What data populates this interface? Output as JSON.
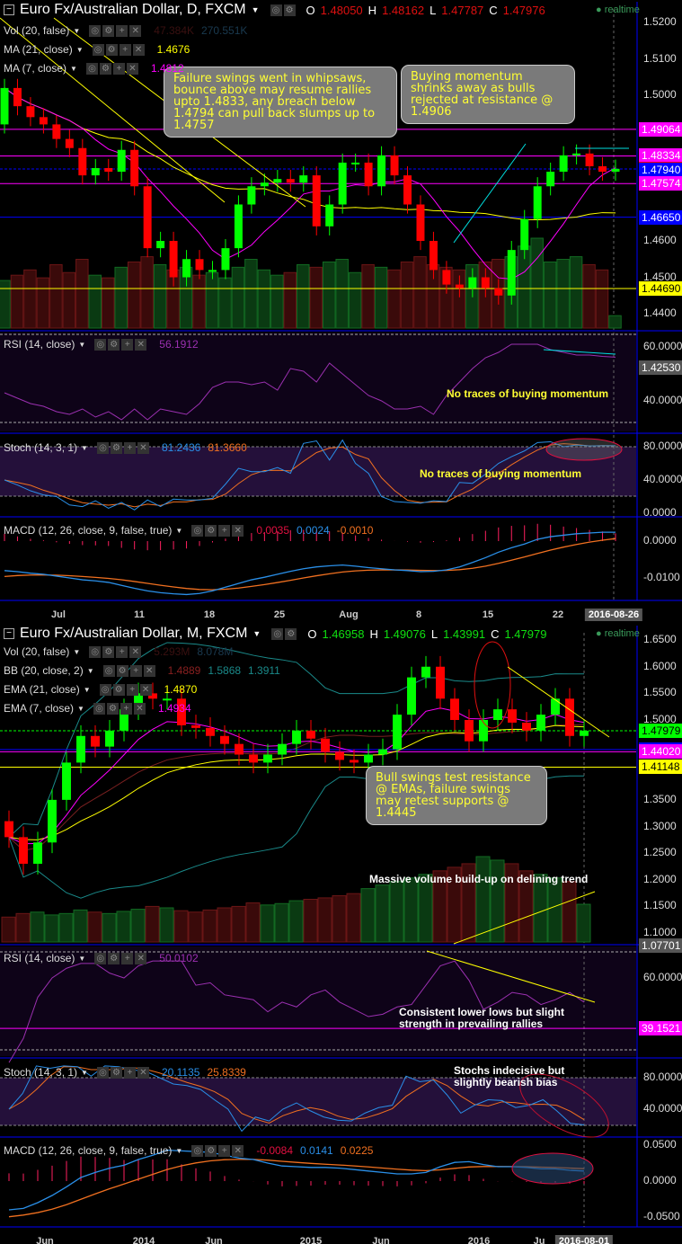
{
  "top": {
    "title": "Euro Fx/Australian Dollar, D, FXCM",
    "o_label": "O",
    "o": "1.48050",
    "h_label": "H",
    "h": "1.48162",
    "l_label": "L",
    "l": "1.47787",
    "c_label": "C",
    "c": "1.47976",
    "realtime": "realtime",
    "indicators": [
      {
        "label": "Vol (20, false)",
        "values": [
          "47.384K",
          "270.551K"
        ]
      },
      {
        "label": "MA (21, close)",
        "values": [
          "1.4676"
        ]
      },
      {
        "label": "MA (7, close)",
        "values": [
          "1.4812"
        ]
      }
    ],
    "rsi": {
      "label": "RSI (14, close)",
      "value": "56.1912"
    },
    "stoch": {
      "label": "Stoch (14, 3, 1)",
      "k": "81.2436",
      "d": "81.3660"
    },
    "macd": {
      "label": "MACD (12, 26, close, 9, false, true)",
      "hist": "0.0035",
      "macd": "0.0024",
      "signal": "-0.0010"
    },
    "notes": [
      "Failure swings went in whipsaws, bounce above may resume rallies upto 1.4833, any breach below 1.4794 can pull back slumps up to 1.4757",
      "Buying momentum shrinks away as bulls rejected at resistance @ 1.4906",
      "No traces of buying momentum",
      "No traces of buying momentum"
    ],
    "price_ticks": [
      "1.5200",
      "1.5100",
      "1.5000",
      "1.4600",
      "1.4500",
      "1.4400"
    ],
    "markers": [
      {
        "text": "1.49064",
        "bg": "#ff00ff",
        "fg": "#fff"
      },
      {
        "text": "1.48334",
        "bg": "#ff00ff",
        "fg": "#fff"
      },
      {
        "text": "1.47976",
        "bg": "#ff0000",
        "fg": "#fff"
      },
      {
        "text": "1.47940",
        "bg": "#0000ff",
        "fg": "#fff"
      },
      {
        "text": "1.47574",
        "bg": "#ff00ff",
        "fg": "#fff"
      },
      {
        "text": "1.46650",
        "bg": "#0000ff",
        "fg": "#fff"
      },
      {
        "text": "1.44690",
        "bg": "#ffff00",
        "fg": "#000"
      },
      {
        "text": "1.42530",
        "bg": "#555",
        "fg": "#fff"
      }
    ],
    "rsi_ticks": [
      "60.0000",
      "40.0000"
    ],
    "stoch_ticks": [
      "80.0000",
      "40.0000",
      "0.0000"
    ],
    "macd_ticks": [
      "0.0000",
      "-0.0100"
    ],
    "time_labels": [
      "Jul",
      "11",
      "18",
      "25",
      "Aug",
      "8",
      "15",
      "22"
    ],
    "date_box": "2016-08-26"
  },
  "bottom": {
    "title": "Euro Fx/Australian Dollar, M, FXCM",
    "o_label": "O",
    "o": "1.46958",
    "h_label": "H",
    "h": "1.49076",
    "l_label": "L",
    "l": "1.43991",
    "c_label": "C",
    "c": "1.47979",
    "realtime": "realtime",
    "indicators": [
      {
        "label": "Vol (20, false)",
        "values": [
          "5.293M",
          "8.078M"
        ]
      },
      {
        "label": "BB (20, close, 2)",
        "values": [
          "1.4889",
          "1.5868",
          "1.3911"
        ]
      },
      {
        "label": "EMA (21, close)",
        "values": [
          "1.4870"
        ]
      },
      {
        "label": "EMA (7, close)",
        "values": [
          "1.4934"
        ]
      }
    ],
    "rsi": {
      "label": "RSI (14, close)",
      "value": "50.0102"
    },
    "stoch": {
      "label": "Stoch (14, 3, 1)",
      "k": "20.1135",
      "d": "25.8339"
    },
    "macd": {
      "label": "MACD (12, 26, close, 9, false, true)",
      "hist": "-0.0084",
      "macd": "0.0141",
      "signal": "0.0225"
    },
    "notes": [
      "Bull swings test resistance @ EMAs, failure swings may retest supports @ 1.4445",
      "Massive volume build-up on delining trend",
      "Consistent lower lows but slight strength in prevailing rallies",
      "Stochs indecisive but slightly bearish bias"
    ],
    "price_ticks": [
      "1.6500",
      "1.6000",
      "1.5500",
      "1.5000",
      "1.3500",
      "1.3000",
      "1.2500",
      "1.2000",
      "1.1500",
      "1.1000"
    ],
    "markers": [
      {
        "text": "1.47979",
        "bg": "#00ff00",
        "fg": "#000"
      },
      {
        "text": "1.44457",
        "bg": "#0000ff",
        "fg": "#fff"
      },
      {
        "text": "1.44020",
        "bg": "#ff00ff",
        "fg": "#fff"
      },
      {
        "text": "1.41148",
        "bg": "#ffff00",
        "fg": "#000"
      },
      {
        "text": "1.07701",
        "bg": "#555",
        "fg": "#fff"
      }
    ],
    "rsi_ticks": [
      "60.0000"
    ],
    "rsi_marker": "39.1521",
    "stoch_ticks": [
      "80.0000",
      "40.0000"
    ],
    "macd_ticks": [
      "0.0500",
      "0.0000",
      "-0.0500"
    ],
    "time_labels": [
      "Jun",
      "2014",
      "Jun",
      "2015",
      "Jun",
      "2016",
      "Ju"
    ],
    "date_box": "2016-08-01"
  },
  "colors": {
    "up": "#00ff00",
    "down": "#ff0000",
    "ma7": "#ff00ff",
    "ma21": "#ffff00",
    "rsi": "#9b30b0",
    "k": "#2a8fe8",
    "d": "#f07020",
    "hist": "#ff2060",
    "bb": "#1a8a8a"
  },
  "chart_data": [
    {
      "type": "candlestick",
      "title": "Euro Fx/Australian Dollar, D, FXCM",
      "ylim": [
        1.425,
        1.525
      ],
      "closes": [
        1.502,
        1.497,
        1.494,
        1.492,
        1.488,
        1.4855,
        1.478,
        1.48,
        1.479,
        1.485,
        1.475,
        1.458,
        1.46,
        1.45,
        1.455,
        1.452,
        1.452,
        1.458,
        1.47,
        1.475,
        1.476,
        1.477,
        1.476,
        1.478,
        1.464,
        1.47,
        1.4815,
        1.4815,
        1.475,
        1.4835,
        1.478,
        1.47,
        1.46,
        1.452,
        1.448,
        1.447,
        1.45,
        1.447,
        1.445,
        1.4575,
        1.466,
        1.475,
        1.479,
        1.4835,
        1.484,
        1.4805,
        1.479,
        1.4798
      ],
      "first_open": 1.492,
      "volumes_k": [
        180,
        200,
        220,
        190,
        240,
        210,
        260,
        200,
        190,
        230,
        250,
        270,
        240,
        220,
        230,
        200,
        210,
        190,
        230,
        260,
        220,
        200,
        210,
        240,
        230,
        250,
        260,
        210,
        240,
        230,
        220,
        250,
        270,
        240,
        230,
        220,
        240,
        250,
        260,
        270,
        310,
        340,
        250,
        260,
        270,
        240,
        220,
        47
      ],
      "rsi": [
        43,
        41,
        39,
        38,
        36,
        35,
        37,
        34,
        36,
        33,
        37,
        33,
        37,
        36,
        35,
        39,
        45,
        47,
        47,
        46,
        47,
        44,
        52,
        51,
        47,
        54,
        50,
        46,
        42,
        40,
        37,
        37,
        38,
        35,
        42,
        47,
        52,
        56,
        58,
        61,
        61,
        61,
        59,
        58,
        57,
        57,
        56.5,
        56.2
      ],
      "stoch_k": [
        40,
        34,
        27,
        22,
        20,
        10,
        8,
        15,
        6,
        13,
        4,
        16,
        8,
        17,
        16,
        16,
        18,
        35,
        54,
        50,
        50,
        55,
        48,
        84,
        87,
        64,
        88,
        60,
        48,
        20,
        14,
        13,
        12,
        15,
        14,
        37,
        36,
        47,
        60,
        68,
        75,
        85,
        86,
        80,
        82,
        81,
        81.2,
        81.2
      ],
      "macd": [
        -0.008,
        -0.0083,
        -0.0087,
        -0.009,
        -0.0095,
        -0.01,
        -0.0105,
        -0.0108,
        -0.0112,
        -0.012,
        -0.0128,
        -0.0135,
        -0.014,
        -0.0143,
        -0.0145,
        -0.0142,
        -0.0135,
        -0.0125,
        -0.0115,
        -0.0105,
        -0.0098,
        -0.009,
        -0.0082,
        -0.0075,
        -0.007,
        -0.0067,
        -0.0065,
        -0.0068,
        -0.0072,
        -0.0075,
        -0.0078,
        -0.008,
        -0.0083,
        -0.0082,
        -0.0078,
        -0.007,
        -0.0058,
        -0.0045,
        -0.003,
        -0.0018,
        -0.0008,
        0.0005,
        0.0012,
        0.0016,
        0.002,
        0.0022,
        0.0024,
        0.0024
      ]
    },
    {
      "type": "candlestick",
      "title": "Euro Fx/Australian Dollar, M, FXCM",
      "ylim": [
        1.077,
        1.65
      ],
      "closes": [
        1.28,
        1.23,
        1.27,
        1.35,
        1.42,
        1.47,
        1.45,
        1.48,
        1.52,
        1.55,
        1.54,
        1.54,
        1.49,
        1.485,
        1.47,
        1.455,
        1.435,
        1.42,
        1.435,
        1.455,
        1.48,
        1.465,
        1.44,
        1.425,
        1.42,
        1.435,
        1.445,
        1.51,
        1.58,
        1.6,
        1.54,
        1.5,
        1.46,
        1.5,
        1.52,
        1.495,
        1.48,
        1.51,
        1.54,
        1.47,
        1.4798
      ],
      "first_open": 1.31,
      "volumes_m": [
        3.5,
        4.0,
        4.2,
        3.8,
        4.0,
        4.5,
        4.2,
        4.0,
        4.3,
        4.6,
        5.0,
        4.8,
        4.4,
        4.2,
        4.5,
        4.8,
        5.0,
        5.5,
        5.2,
        5.4,
        5.8,
        6.0,
        6.2,
        6.5,
        6.8,
        7.5,
        8.0,
        8.5,
        9.0,
        9.5,
        10.0,
        10.5,
        11.0,
        12.0,
        11.5,
        11.0,
        10.0,
        9.5,
        9.0,
        8.5,
        5.3
      ],
      "rsi": [
        25,
        35,
        52,
        60,
        64,
        66,
        66,
        62,
        60,
        65,
        67,
        67,
        67,
        57,
        58,
        53,
        52,
        51,
        46,
        50,
        48,
        53,
        55,
        50,
        47,
        44,
        45,
        48,
        49,
        57,
        65,
        67,
        59,
        47,
        50,
        54,
        53,
        49,
        51,
        54,
        50
      ],
      "stoch_k": [
        40,
        60,
        95,
        92,
        95,
        94,
        82,
        95,
        94,
        90,
        88,
        80,
        72,
        70,
        65,
        52,
        40,
        12,
        30,
        25,
        40,
        48,
        38,
        30,
        26,
        25,
        35,
        42,
        45,
        82,
        75,
        77,
        58,
        35,
        45,
        52,
        51,
        42,
        45,
        52,
        38,
        22,
        20
      ],
      "macd": [
        -0.04,
        -0.038,
        -0.03,
        -0.02,
        -0.008,
        0.005,
        0.012,
        0.018,
        0.022,
        0.03,
        0.036,
        0.043,
        0.042,
        0.041,
        0.04,
        0.036,
        0.032,
        0.03,
        0.025,
        0.021,
        0.02,
        0.019,
        0.019,
        0.018,
        0.016,
        0.014,
        0.012,
        0.01,
        0.01,
        0.012,
        0.02,
        0.026,
        0.027,
        0.023,
        0.02,
        0.02,
        0.019,
        0.017,
        0.017,
        0.015,
        0.014
      ]
    }
  ]
}
